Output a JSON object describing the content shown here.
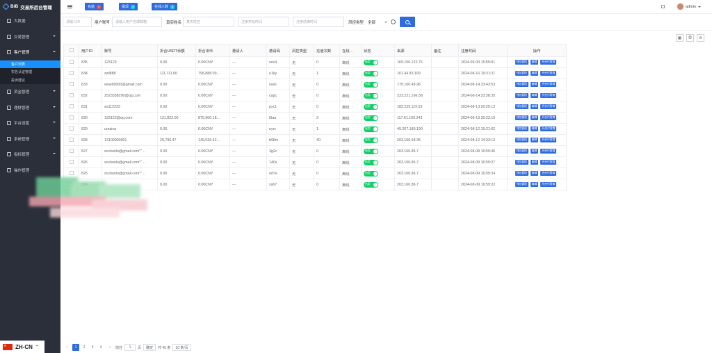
{
  "sidebar": {
    "brand": "交易所后台管理",
    "brand_logo_text": "BiB",
    "items": [
      {
        "label": "大数据",
        "icon": "dashboard-icon",
        "has_arrow": false
      },
      {
        "label": "交易管理",
        "icon": "trade-icon",
        "has_arrow": true
      },
      {
        "label": "客户管理",
        "icon": "users-icon",
        "has_arrow": true,
        "open": true
      },
      {
        "label": "资金管理",
        "icon": "wallet-icon",
        "has_arrow": true
      },
      {
        "label": "理财管理",
        "icon": "cloud-icon",
        "has_arrow": true
      },
      {
        "label": "平台设置",
        "icon": "gear-icon",
        "has_arrow": true
      },
      {
        "label": "系统管理",
        "icon": "system-icon",
        "has_arrow": true
      },
      {
        "label": "指标管理",
        "icon": "chart-icon",
        "has_arrow": true
      },
      {
        "label": "操作管理",
        "icon": "log-icon",
        "has_arrow": false
      }
    ],
    "submenu": [
      {
        "label": "客户列表",
        "active": true
      },
      {
        "label": "实名认证管理",
        "active": false
      },
      {
        "label": "投诉建议",
        "active": false
      }
    ],
    "language": "ZH-CN"
  },
  "topbar": {
    "buttons": [
      {
        "label": "充值",
        "badge": "3",
        "badge_color": "#e94c4c"
      },
      {
        "label": "提现",
        "badge": "1",
        "badge_color": "#1ec8d8"
      },
      {
        "label": "在线人数",
        "badge": "3",
        "badge_color": "#1ec8d8"
      }
    ],
    "user": "admin"
  },
  "filters": {
    "user_id_placeholder": "请输入ID",
    "account_label": "用户账号",
    "account_placeholder": "请输入用户名或邮箱",
    "realname_label": "真实姓名",
    "realname_placeholder": "真实姓名",
    "reg_start_placeholder": "注册开始时间",
    "reg_end_placeholder": "注册结束时间",
    "risk_label": "风控类型",
    "risk_value": "全部"
  },
  "table": {
    "headers": [
      "用户ID",
      "账号",
      "折合USDT余额",
      "折合法币",
      "邀请人",
      "邀请码",
      "风控类型",
      "充值次数",
      "在线...",
      "状态",
      "来源",
      "备注",
      "注册时间",
      "操作"
    ],
    "status_label": "启用",
    "action_labels": [
      "钱包管理",
      "编辑",
      "折合代理商"
    ],
    "rows": [
      [
        "835",
        "123123",
        "0.00",
        "0.00CNY",
        "---",
        "soc4",
        "无",
        "0",
        "离线",
        "",
        "169.150.222.76",
        "",
        "2024-09-03 15:59:01"
      ],
      [
        "834",
        "zwl888",
        "111,111.00",
        "796,888.09...",
        "---",
        "u1ky",
        "无",
        "1",
        "离线",
        "",
        "101.44.83.169",
        "",
        "2024-08-16 19:31:31"
      ],
      [
        "833",
        "wow69000@gmail.com",
        "0.00",
        "0.00CNY",
        "---",
        "owzi",
        "无",
        "0",
        "离线",
        "",
        "175.100.48.96",
        "",
        "2024-08-14 23:43:53"
      ],
      [
        "832",
        "2523358290@qq.com",
        "0.00",
        "0.00CNY",
        "---",
        "capc",
        "无",
        "0",
        "离线",
        "",
        "223.221.166.58",
        "",
        "2024-08-14 23:38:35"
      ],
      [
        "831",
        "as112233",
        "0.00",
        "0.00CNY",
        "---",
        "pxc1",
        "无",
        "0",
        "离线",
        "",
        "182.239.119.53",
        "",
        "2024-08-13 20:25:13"
      ],
      [
        "830",
        "123123@qq.com",
        "121,822.00",
        "875,900.18...",
        "---",
        "t9aa",
        "无",
        "2",
        "离线",
        "",
        "117.61.109.243",
        "",
        "2024-08-13 20:22:10"
      ],
      [
        "829",
        "umaiva",
        "0.00",
        "0.00CNY",
        "---",
        "uyrc",
        "无",
        "1",
        "离线",
        "",
        "49.207.180.190",
        "",
        "2024-08-12 15:21:02"
      ],
      [
        "828",
        "13100000001",
        "20,796.47",
        "149,526.62...",
        "---",
        "b98m",
        "无",
        "40",
        "离线",
        "",
        "203.160.68.35",
        "",
        "2024-08-12 14:33:13"
      ],
      [
        "827",
        "scshunlo@gmail.com\"\"...",
        "0.00",
        "0.00CNY",
        "---",
        "3g2c",
        "无",
        "0",
        "离线",
        "",
        "203.160.86.7",
        "",
        "2024-08-09 16:59:40"
      ],
      [
        "826",
        "scshunlo@gmail.com\"\"...",
        "0.00",
        "0.00CNY",
        "---",
        "140s",
        "无",
        "0",
        "离线",
        "",
        "203.160.86.7",
        "",
        "2024-08-09 16:59:37"
      ],
      [
        "825",
        "scshunlo@gmail.com\"\"...",
        "0.00",
        "0.00CNY",
        "---",
        "od7e",
        "无",
        "0",
        "离线",
        "",
        "203.160.86.7",
        "",
        "2024-08-09 16:59:34"
      ],
      [
        "824",
        "",
        "0.00",
        "0.00CNY",
        "---",
        "ss67",
        "无",
        "0",
        "离线",
        "",
        "203.160.86.7",
        "",
        "2024-08-09 16:59:32"
      ]
    ]
  },
  "pager": {
    "pages": [
      "1",
      "2",
      "3",
      "4"
    ],
    "goto_label": "前往",
    "goto_value": "1",
    "page_unit": "页",
    "confirm_label": "确定",
    "total": "共 45 条",
    "page_size": "10 条/页"
  }
}
